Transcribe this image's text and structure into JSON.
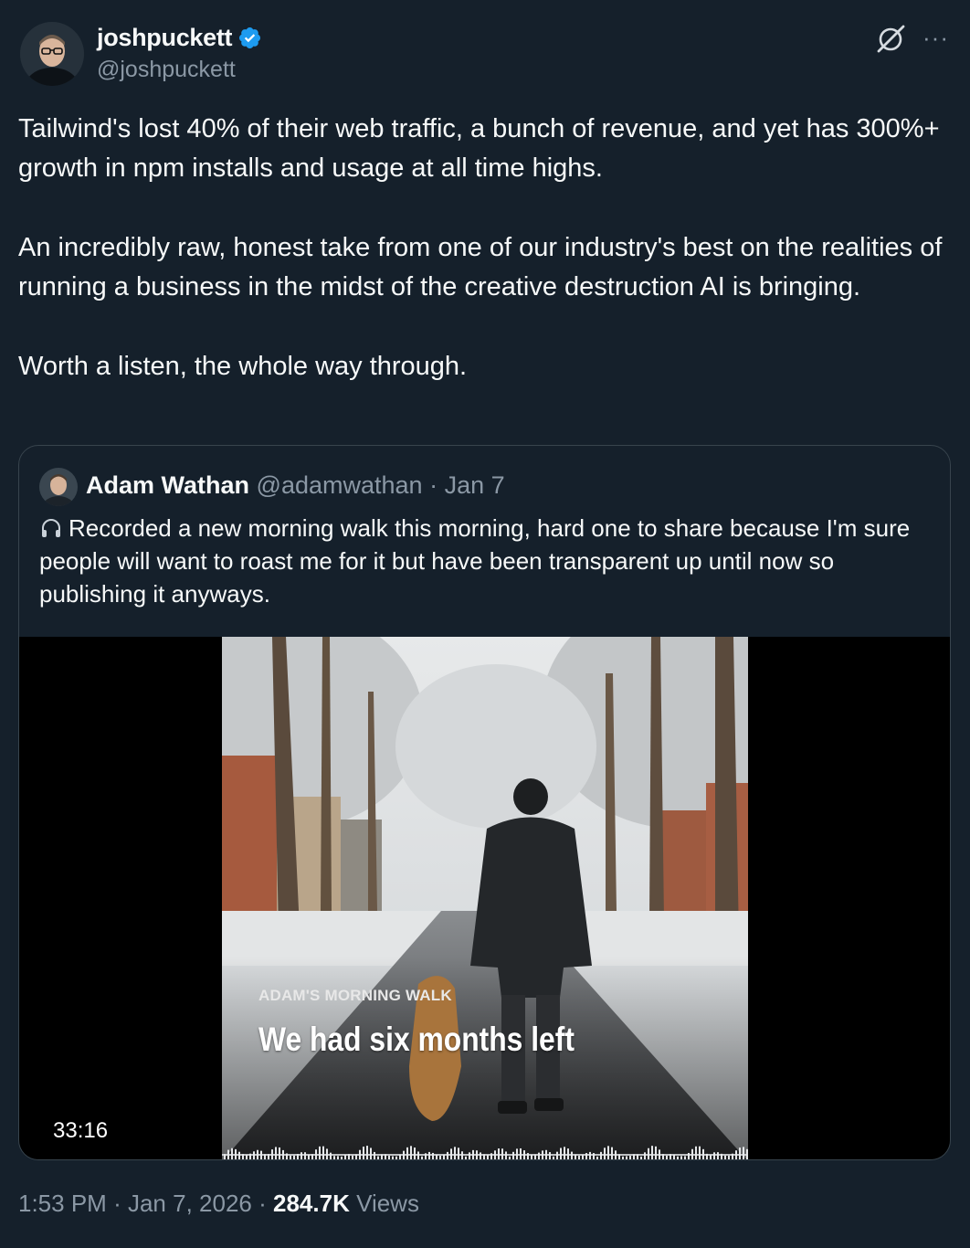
{
  "author": {
    "display_name": "joshpuckett",
    "handle": "@joshpuckett",
    "verified": true
  },
  "icons": {
    "verified": "verified-badge-icon",
    "grok": "grok-icon",
    "more": "more-options-icon",
    "headphones": "headphones-icon"
  },
  "colors": {
    "background": "#15202b",
    "text": "#f7f9f9",
    "muted": "#8b98a5",
    "verified": "#1d9bf0",
    "border": "#38444d"
  },
  "tweet": {
    "paragraphs": [
      "Tailwind's lost 40% of their web traffic, a bunch of revenue, and yet has 300%+ growth in npm installs and usage at all time highs.",
      "An incredibly raw, honest take from one of our industry's best on the realities of running a business in the midst of the creative destruction AI is bringing.",
      "Worth a listen, the whole way through."
    ]
  },
  "quote": {
    "display_name": "Adam Wathan",
    "handle": "@adamwathan",
    "separator": "·",
    "date": "Jan 7",
    "text": "Recorded a new morning walk this morning, hard one to share because I'm sure people will want to roast me for it but have been transparent up until now so publishing it anyways.",
    "video": {
      "kicker": "ADAM'S MORNING WALK",
      "title": "We had six months left",
      "duration": "33:16"
    }
  },
  "footer": {
    "time": "1:53 PM",
    "separator": "·",
    "date": "Jan 7, 2026",
    "views_count": "284.7K",
    "views_label": "Views"
  }
}
